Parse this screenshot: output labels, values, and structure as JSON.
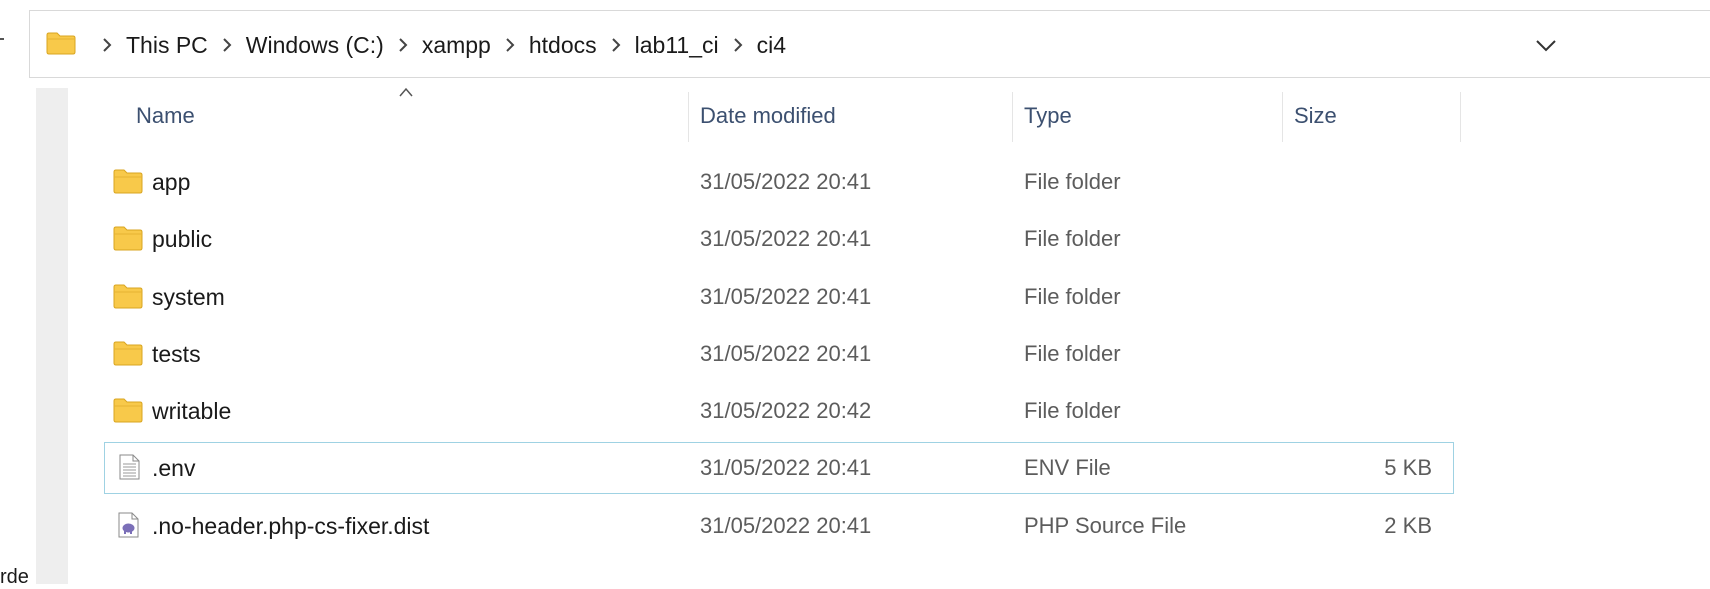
{
  "address_bar": {
    "breadcrumb": [
      "This PC",
      "Windows (C:)",
      "xampp",
      "htdocs",
      "lab11_ci",
      "ci4"
    ]
  },
  "nav_pane": {
    "partial_text": "rde"
  },
  "columns": {
    "name": "Name",
    "date": "Date modified",
    "type": "Type",
    "size": "Size"
  },
  "files": [
    {
      "name": "app",
      "date": "31/05/2022 20:41",
      "type": "File folder",
      "size": "",
      "icon": "folder-icon"
    },
    {
      "name": "public",
      "date": "31/05/2022 20:41",
      "type": "File folder",
      "size": "",
      "icon": "folder-icon"
    },
    {
      "name": "system",
      "date": "31/05/2022 20:41",
      "type": "File folder",
      "size": "",
      "icon": "folder-icon"
    },
    {
      "name": "tests",
      "date": "31/05/2022 20:41",
      "type": "File folder",
      "size": "",
      "icon": "folder-icon"
    },
    {
      "name": "writable",
      "date": "31/05/2022 20:42",
      "type": "File folder",
      "size": "",
      "icon": "folder-icon"
    },
    {
      "name": ".env",
      "date": "31/05/2022 20:41",
      "type": "ENV File",
      "size": "5 KB",
      "icon": "text-file-icon",
      "selected": true
    },
    {
      "name": ".no-header.php-cs-fixer.dist",
      "date": "31/05/2022 20:41",
      "type": "PHP Source File",
      "size": "2 KB",
      "icon": "php-file-icon"
    }
  ],
  "colors": {
    "folder": "#f8c94a",
    "header_text": "#3c5070",
    "selection_border": "#9fd2e3"
  }
}
